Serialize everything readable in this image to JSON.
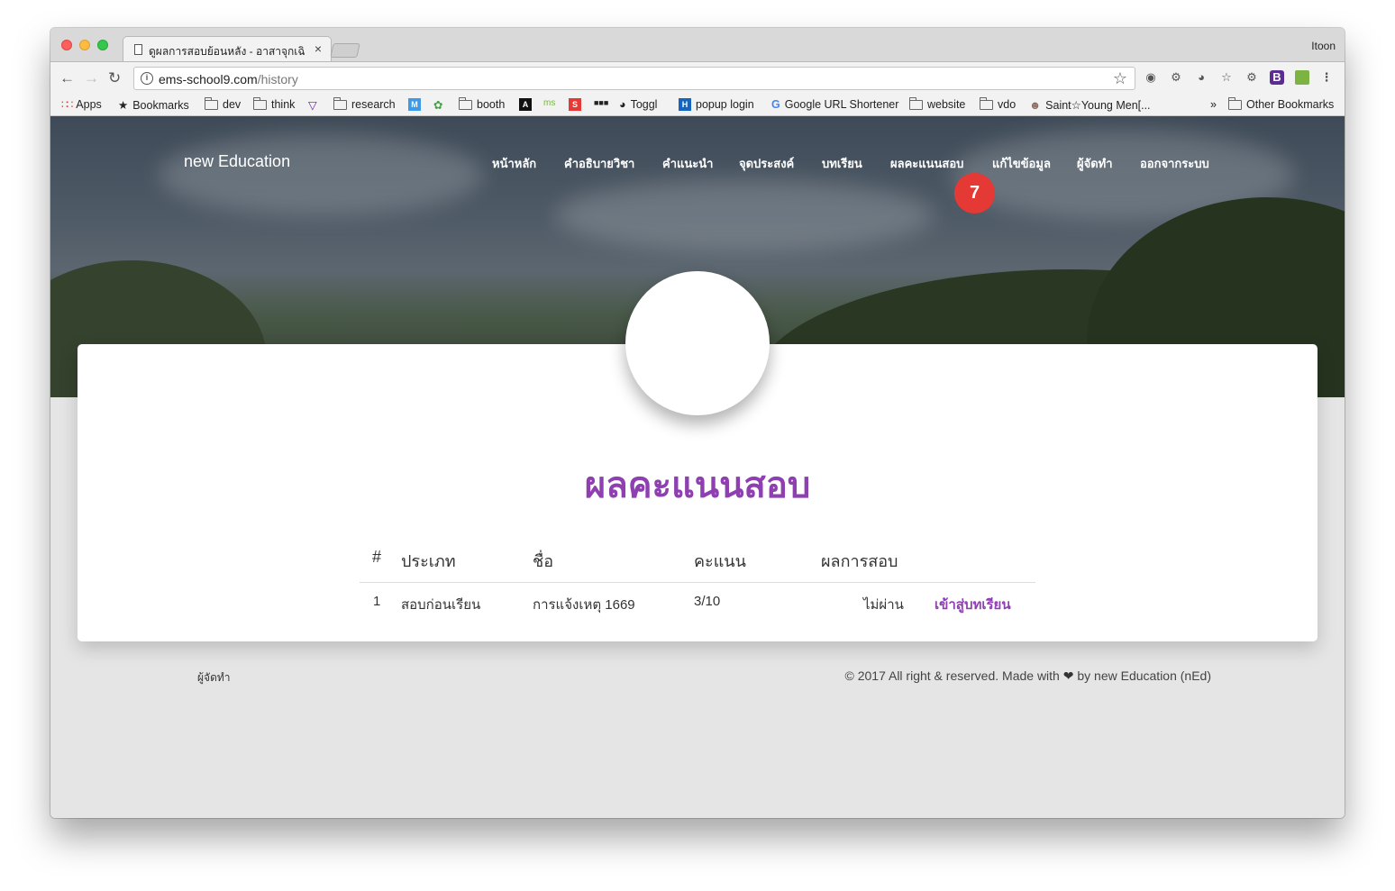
{
  "browser": {
    "tab_title": "ดูผลการสอบย้อนหลัง - อาสาจุกเฉิ",
    "tab_close": "×",
    "profile_name": "Itoon",
    "url_host": "ems-school9.com",
    "url_path": "/history",
    "bookmarks": [
      {
        "label": "Apps",
        "icon": "apps-grid-icon"
      },
      {
        "label": "Bookmarks",
        "icon": "star-icon"
      },
      {
        "label": "dev",
        "icon": "folder-icon"
      },
      {
        "label": "think",
        "icon": "folder-icon"
      },
      {
        "label": "research",
        "icon": "folder-icon"
      },
      {
        "label": "booth",
        "icon": "folder-icon"
      },
      {
        "label": "Toggl",
        "icon": "toggl-icon"
      },
      {
        "label": "popup login",
        "icon": "h-icon"
      },
      {
        "label": "Google URL Shortener",
        "icon": "google-icon"
      },
      {
        "label": "website",
        "icon": "folder-icon"
      },
      {
        "label": "vdo",
        "icon": "folder-icon"
      },
      {
        "label": "Saint☆Young Men[...",
        "icon": "manga-icon"
      },
      {
        "label": "»",
        "icon": "overflow-icon"
      },
      {
        "label": "Other Bookmarks",
        "icon": "folder-icon"
      }
    ]
  },
  "site": {
    "brand": "new Education",
    "nav": [
      "หน้าหลัก",
      "คำอธิบายวิชา",
      "คำแนะนำ",
      "จุดประสงค์",
      "บทเรียน",
      "ผลคะแนนสอบ",
      "แก้ไขข้อมูล",
      "ผู้จัดทำ",
      "ออกจากระบบ"
    ],
    "notification_count": "7"
  },
  "main": {
    "title": "ผลคะแนนสอบ",
    "table": {
      "headers": [
        "#",
        "ประเภท",
        "ชื่อ",
        "คะแนน",
        "ผลการสอบ"
      ],
      "rows": [
        {
          "num": "1",
          "type": "สอบก่อนเรียน",
          "name": "การแจ้งเหตุ 1669",
          "score": "3/10",
          "result": "ไม่ผ่าน",
          "action": "เข้าสู่บทเรียน"
        }
      ]
    }
  },
  "footer": {
    "left": "ผู้จัดทำ",
    "right_before": "© 2017 All right & reserved. Made with",
    "heart": "❤",
    "right_after": "by new Education (nEd)"
  }
}
